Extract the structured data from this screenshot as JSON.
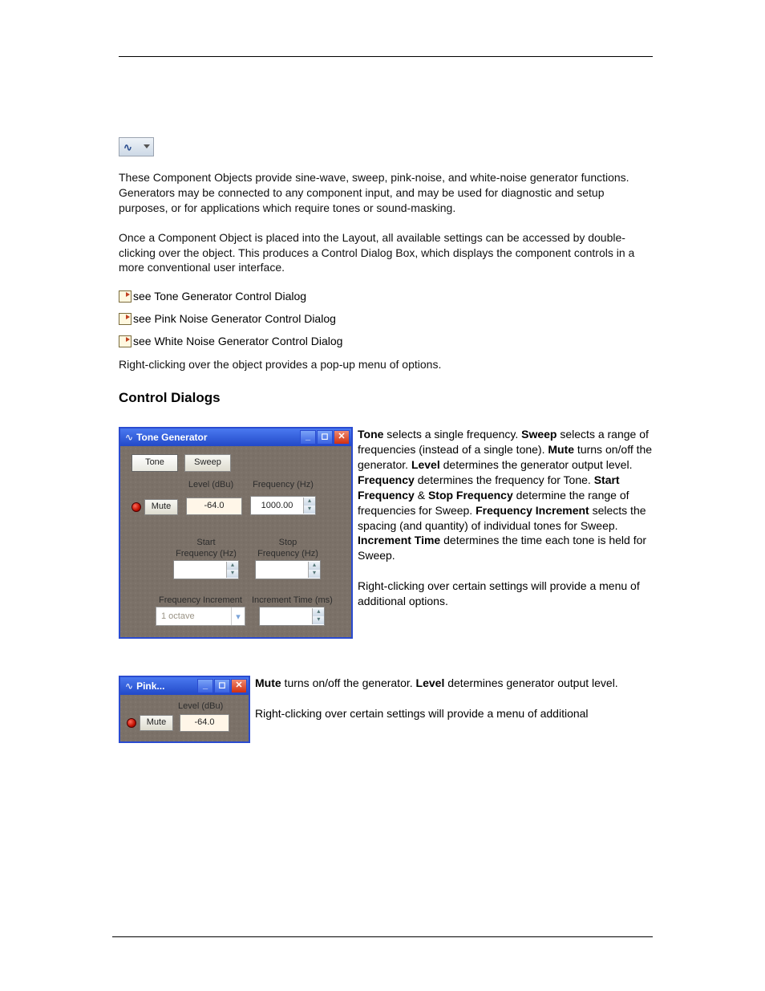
{
  "intro": {
    "p1": "These Component Objects provide sine-wave, sweep, pink-noise, and white-noise generator functions. Generators may be connected to any component input, and may be used for diagnostic and setup purposes, or for applications which require tones or sound-masking.",
    "p2": "Once a Component Object is placed into the Layout, all available settings can be accessed by double-clicking over the object. This produces a Control Dialog Box, which displays the component controls in a more conventional user interface."
  },
  "see_links": [
    "see Tone Generator Control Dialog",
    "see Pink Noise Generator Control Dialog",
    "see White Noise Generator Control Dialog"
  ],
  "right_click_note": "Right-clicking over the object provides a pop-up menu of options.",
  "section_heading": "Control Dialogs",
  "tone_dialog": {
    "title": "Tone Generator",
    "tabs": {
      "tone": "Tone",
      "sweep": "Sweep"
    },
    "labels": {
      "level": "Level (dBu)",
      "freq": "Frequency (Hz)",
      "start": "Start",
      "start_freq": "Frequency (Hz)",
      "stop": "Stop",
      "stop_freq": "Frequency (Hz)",
      "freq_inc": "Frequency Increment",
      "inc_time": "Increment Time (ms)",
      "mute": "Mute"
    },
    "values": {
      "level": "-64.0",
      "freq": "1000.00",
      "start_freq": "",
      "stop_freq": "",
      "freq_inc": "1 octave",
      "inc_time": ""
    }
  },
  "tone_desc": {
    "tone_b": "Tone",
    "tone_t": " selects a single frequency. ",
    "sweep_b": "Sweep",
    "sweep_t": " selects a range of frequencies (instead of a single tone). ",
    "mute_b": "Mute",
    "mute_t": " turns on/off the generator. ",
    "level_b": "Level",
    "level_t": " determines the generator output level. ",
    "freq_b": "Frequency",
    "freq_t": " determines the frequency for Tone. ",
    "start_b": "Start Frequency",
    "amp": " & ",
    "stop_b": "Stop Frequency",
    "range_t": " determine the range of frequencies for Sweep. ",
    "finc_b": "Frequency Increment",
    "finc_t": " selects the spacing (and quantity) of individual tones for Sweep. ",
    "it_b": "Increment Time",
    "it_t": " determines the time each tone is held for Sweep.",
    "rc": "Right-clicking over certain settings will provide a menu of additional options."
  },
  "pink_dialog": {
    "title": "Pink...",
    "labels": {
      "level": "Level (dBu)",
      "mute": "Mute"
    },
    "values": {
      "level": "-64.0"
    }
  },
  "pink_desc": {
    "mute_b": "Mute",
    "mute_t": " turns on/off the generator. ",
    "level_b": "Level",
    "level_t": " determines generator output level.",
    "rc": "Right-clicking over certain settings will provide a menu of additional"
  }
}
